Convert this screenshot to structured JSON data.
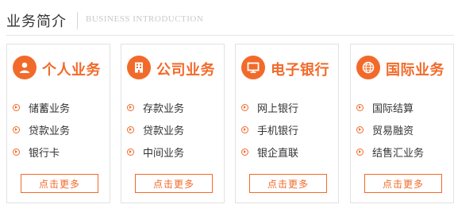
{
  "header": {
    "title": "业务简介",
    "subtitle": "BUSINESS INTRODUCTION"
  },
  "accent_color": "#f26a2a",
  "cards": [
    {
      "title": "个人业务",
      "icon": "person-icon",
      "items": [
        "储蓄业务",
        "贷款业务",
        "银行卡"
      ],
      "more_label": "点击更多"
    },
    {
      "title": "公司业务",
      "icon": "building-icon",
      "items": [
        "存款业务",
        "贷款业务",
        "中间业务"
      ],
      "more_label": "点击更多"
    },
    {
      "title": "电子银行",
      "icon": "monitor-icon",
      "items": [
        "网上银行",
        "手机银行",
        "银企直联"
      ],
      "more_label": "点击更多"
    },
    {
      "title": "国际业务",
      "icon": "globe-icon",
      "items": [
        "国际结算",
        "贸易融资",
        "结售汇业务"
      ],
      "more_label": "点击更多"
    }
  ]
}
